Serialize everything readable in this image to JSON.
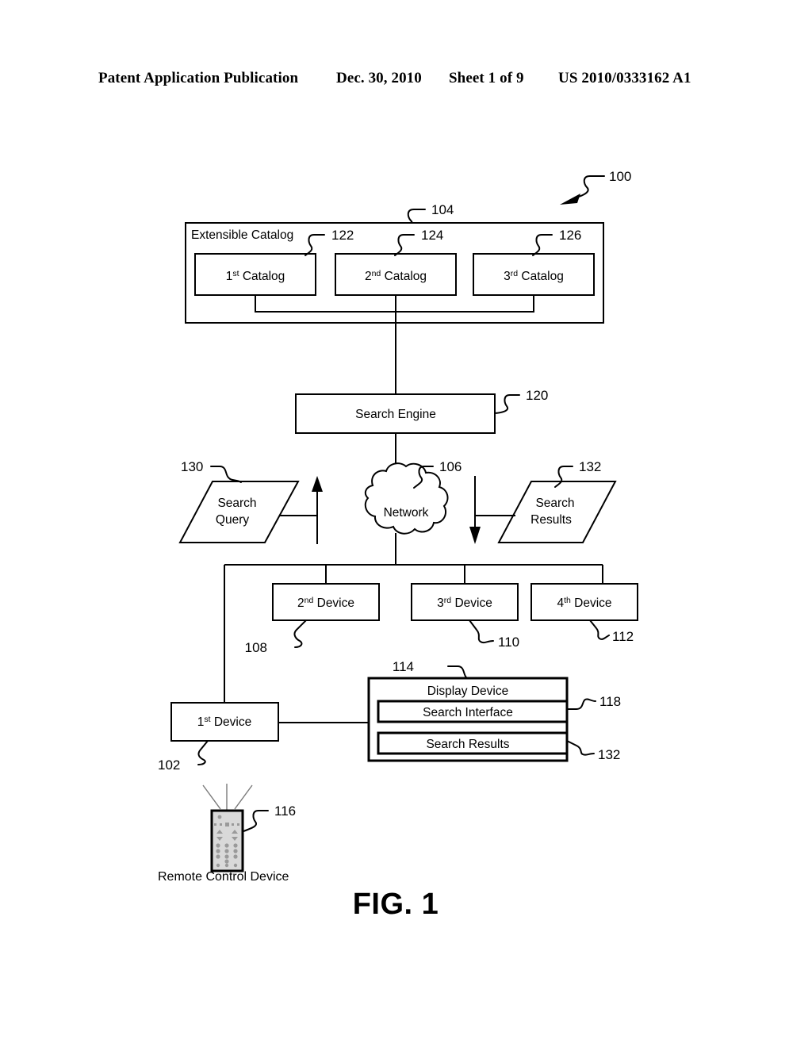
{
  "header": {
    "publication": "Patent Application Publication",
    "date": "Dec. 30, 2010",
    "sheet": "Sheet 1 of 9",
    "number": "US 2010/0333162 A1"
  },
  "figure": {
    "caption": "FIG. 1",
    "system_ref": "100"
  },
  "catalog_group": {
    "title": "Extensible Catalog",
    "ref": "104",
    "catalogs": [
      {
        "prefix": "1",
        "suffix": "st",
        "label": " Catalog",
        "ref": "122"
      },
      {
        "prefix": "2",
        "suffix": "nd",
        "label": " Catalog",
        "ref": "124"
      },
      {
        "prefix": "3",
        "suffix": "rd",
        "label": " Catalog",
        "ref": "126"
      }
    ]
  },
  "search_engine": {
    "label": "Search Engine",
    "ref": "120"
  },
  "network": {
    "label": "Network",
    "ref": "106"
  },
  "search_query": {
    "line1": "Search",
    "line2": "Query",
    "ref": "130"
  },
  "search_results_flow": {
    "line1": "Search",
    "line2": "Results",
    "ref": "132"
  },
  "devices": [
    {
      "prefix": "2",
      "suffix": "nd",
      "label": " Device",
      "ref": "108"
    },
    {
      "prefix": "3",
      "suffix": "rd",
      "label": " Device",
      "ref": "110"
    },
    {
      "prefix": "4",
      "suffix": "th",
      "label": " Device",
      "ref": "112"
    }
  ],
  "first_device": {
    "prefix": "1",
    "suffix": "st",
    "label": " Device",
    "ref": "102"
  },
  "display_device": {
    "title": "Display Device",
    "ref": "114",
    "search_interface": {
      "label": "Search Interface",
      "ref": "118"
    },
    "search_results": {
      "label": "Search Results",
      "ref": "132"
    }
  },
  "remote_control": {
    "label": "Remote Control Device",
    "ref": "116"
  }
}
